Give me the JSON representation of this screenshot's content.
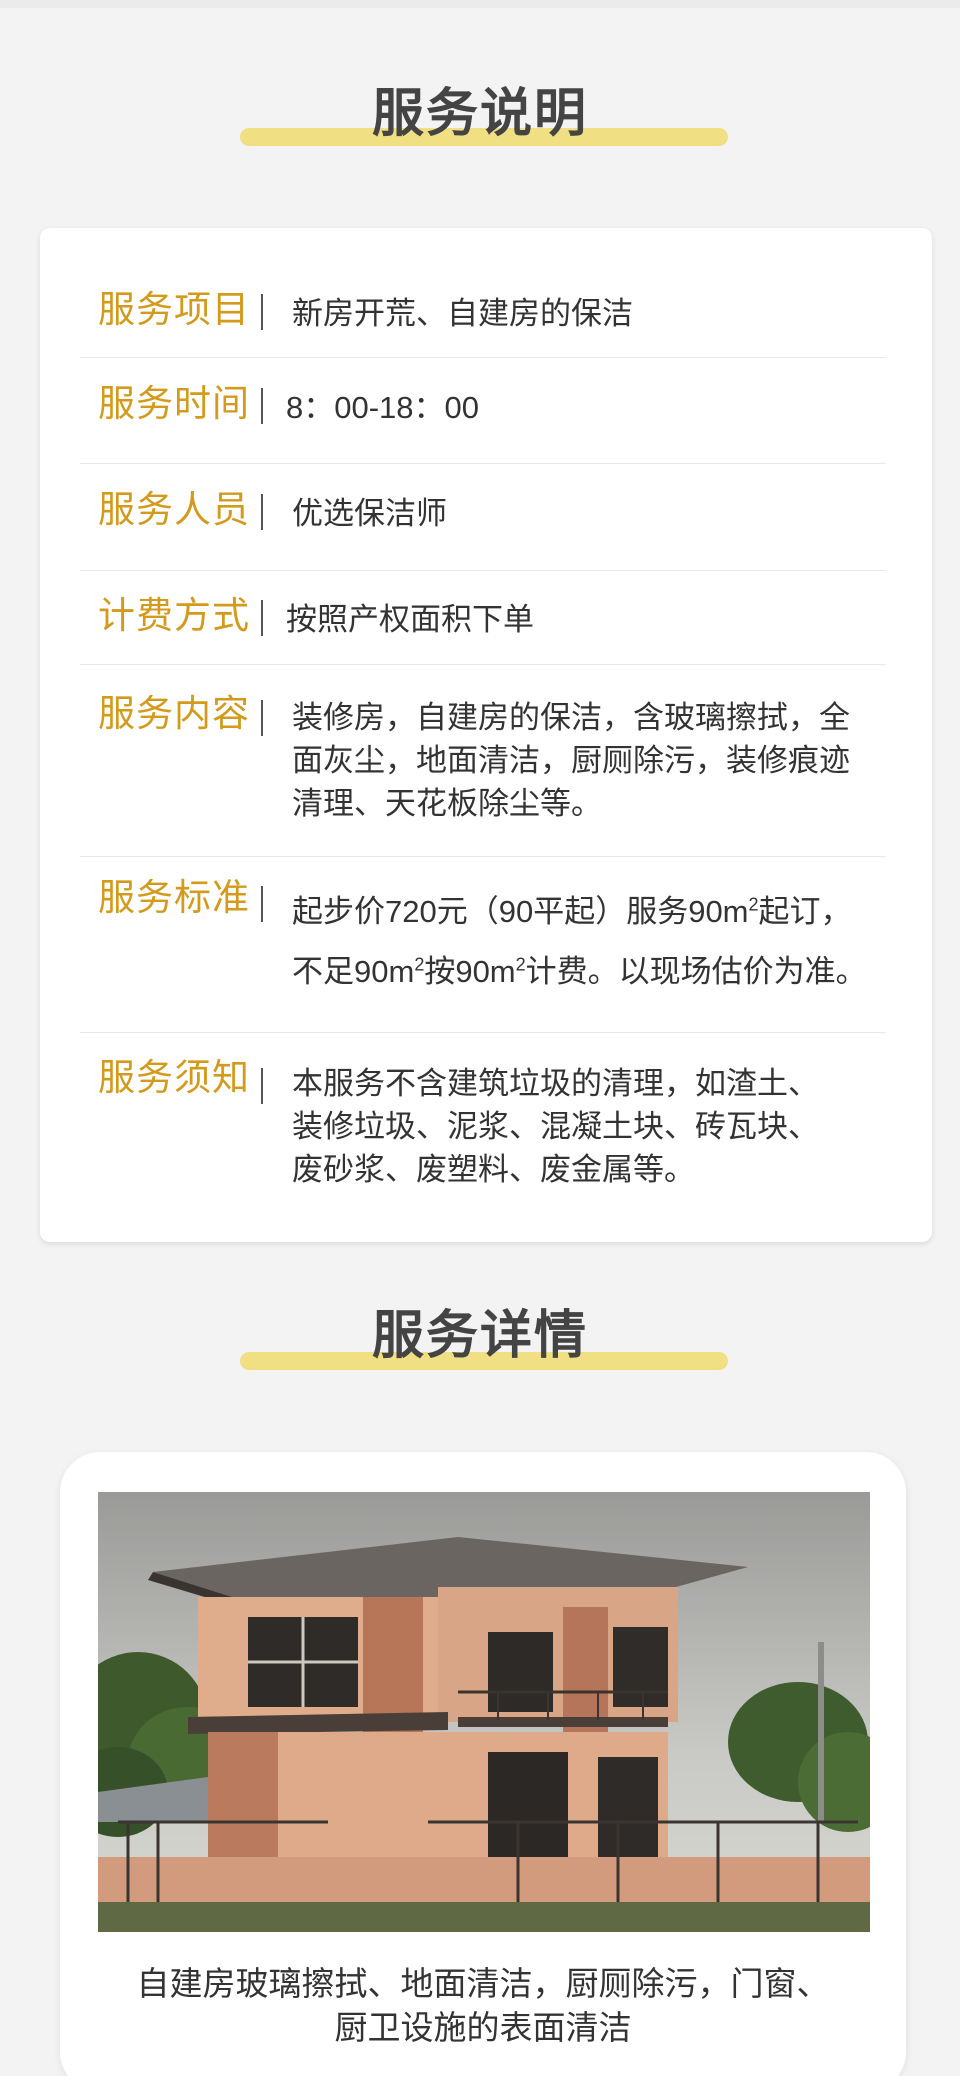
{
  "section1": {
    "title": "服务说明"
  },
  "rows": [
    {
      "label": "服务项目",
      "value": "新房开荒、自建房的保洁"
    },
    {
      "label": "服务时间",
      "value": "8：00-18：00"
    },
    {
      "label": "服务人员",
      "value": "优选保洁师"
    },
    {
      "label": "计费方式",
      "value": "按照产权面积下单"
    },
    {
      "label": "服务内容",
      "lines": [
        "装修房，自建房的保洁，含玻璃擦拭，全",
        "面灰尘，地面清洁，厨厕除污，装修痕迹",
        "清理、天花板除尘等。"
      ]
    },
    {
      "label": "服务标准",
      "line1_a": "起步价720元（90平起）服务90m",
      "line1_b": "起订，",
      "line2_a": "不足90m",
      "line2_b": "按90m",
      "line2_c": "计费。以现场估价为准。",
      "sup": "2"
    },
    {
      "label": "服务须知",
      "lines": [
        "本服务不含建筑垃圾的清理，如渣土、",
        "装修垃圾、泥浆、混凝土块、砖瓦块、",
        "废砂浆、废塑料、废金属等。"
      ]
    }
  ],
  "section2": {
    "title": "服务详情"
  },
  "detail": {
    "caption_lines": [
      "自建房玻璃擦拭、地面清洁，厨厕除污，门窗、",
      "厨卫设施的表面清洁"
    ]
  }
}
